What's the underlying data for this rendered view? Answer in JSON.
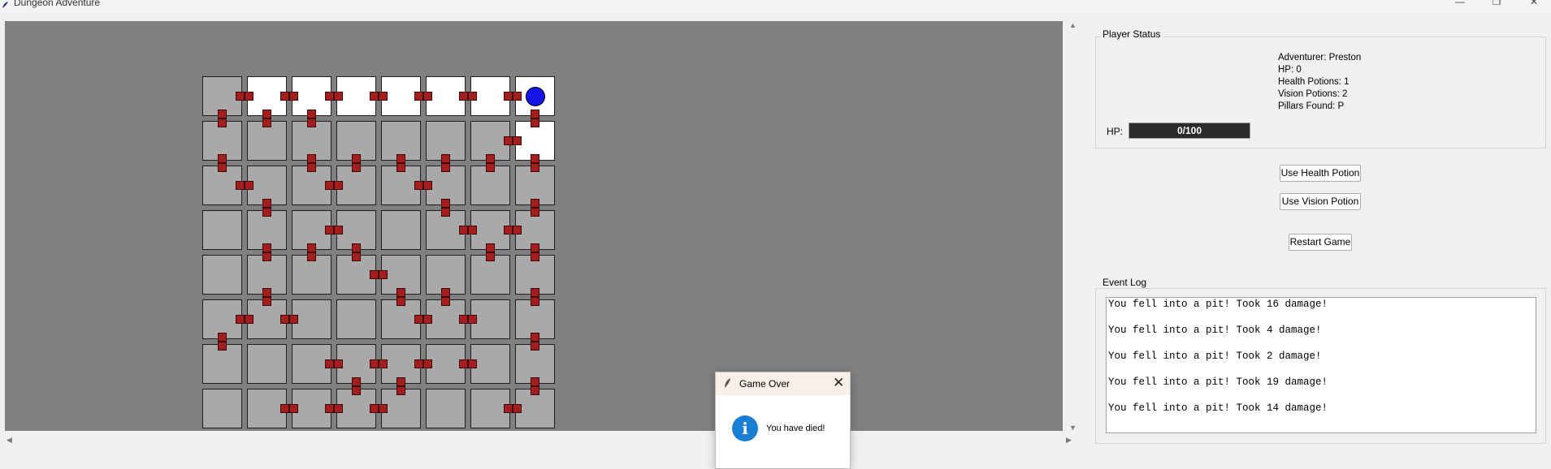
{
  "window": {
    "title": "Dungeon Adventure",
    "controls": {
      "minimize": "—",
      "maximize": "❐",
      "close": "✕"
    }
  },
  "map": {
    "grid_size": 8,
    "player_row": 0,
    "player_col": 7,
    "lit_rooms": [
      [
        0,
        1
      ],
      [
        0,
        2
      ],
      [
        0,
        3
      ],
      [
        0,
        4
      ],
      [
        0,
        5
      ],
      [
        0,
        6
      ],
      [
        0,
        7
      ],
      [
        1,
        7
      ]
    ],
    "doors": [
      [
        0,
        0,
        "E"
      ],
      [
        0,
        0,
        "S"
      ],
      [
        0,
        1,
        "W"
      ],
      [
        0,
        1,
        "E"
      ],
      [
        0,
        1,
        "S"
      ],
      [
        0,
        2,
        "W"
      ],
      [
        0,
        2,
        "E"
      ],
      [
        0,
        2,
        "S"
      ],
      [
        0,
        3,
        "W"
      ],
      [
        0,
        3,
        "E"
      ],
      [
        0,
        4,
        "W"
      ],
      [
        0,
        4,
        "E"
      ],
      [
        0,
        5,
        "W"
      ],
      [
        0,
        5,
        "E"
      ],
      [
        0,
        6,
        "W"
      ],
      [
        0,
        6,
        "E"
      ],
      [
        0,
        7,
        "W"
      ],
      [
        0,
        7,
        "S"
      ],
      [
        1,
        0,
        "N"
      ],
      [
        1,
        0,
        "S"
      ],
      [
        1,
        1,
        "N"
      ],
      [
        1,
        2,
        "N"
      ],
      [
        1,
        2,
        "S"
      ],
      [
        1,
        3,
        "S"
      ],
      [
        1,
        4,
        "S"
      ],
      [
        1,
        5,
        "S"
      ],
      [
        1,
        6,
        "E"
      ],
      [
        1,
        6,
        "S"
      ],
      [
        1,
        7,
        "N"
      ],
      [
        1,
        7,
        "W"
      ],
      [
        1,
        7,
        "S"
      ],
      [
        2,
        0,
        "N"
      ],
      [
        2,
        0,
        "E"
      ],
      [
        2,
        1,
        "W"
      ],
      [
        2,
        1,
        "S"
      ],
      [
        2,
        2,
        "N"
      ],
      [
        2,
        2,
        "E"
      ],
      [
        2,
        3,
        "W"
      ],
      [
        2,
        3,
        "N"
      ],
      [
        2,
        4,
        "N"
      ],
      [
        2,
        4,
        "E"
      ],
      [
        2,
        5,
        "W"
      ],
      [
        2,
        5,
        "N"
      ],
      [
        2,
        5,
        "S"
      ],
      [
        2,
        6,
        "N"
      ],
      [
        2,
        7,
        "N"
      ],
      [
        2,
        7,
        "S"
      ],
      [
        3,
        1,
        "N"
      ],
      [
        3,
        1,
        "S"
      ],
      [
        3,
        2,
        "E"
      ],
      [
        3,
        2,
        "S"
      ],
      [
        3,
        3,
        "W"
      ],
      [
        3,
        3,
        "S"
      ],
      [
        3,
        5,
        "N"
      ],
      [
        3,
        5,
        "E"
      ],
      [
        3,
        6,
        "W"
      ],
      [
        3,
        6,
        "E"
      ],
      [
        3,
        6,
        "S"
      ],
      [
        3,
        7,
        "N"
      ],
      [
        3,
        7,
        "W"
      ],
      [
        3,
        7,
        "S"
      ],
      [
        4,
        1,
        "N"
      ],
      [
        4,
        1,
        "S"
      ],
      [
        4,
        2,
        "N"
      ],
      [
        4,
        3,
        "N"
      ],
      [
        4,
        3,
        "E"
      ],
      [
        4,
        4,
        "W"
      ],
      [
        4,
        4,
        "S"
      ],
      [
        4,
        5,
        "S"
      ],
      [
        4,
        6,
        "N"
      ],
      [
        4,
        7,
        "N"
      ],
      [
        4,
        7,
        "S"
      ],
      [
        5,
        0,
        "E"
      ],
      [
        5,
        0,
        "S"
      ],
      [
        5,
        1,
        "W"
      ],
      [
        5,
        1,
        "N"
      ],
      [
        5,
        1,
        "E"
      ],
      [
        5,
        2,
        "W"
      ],
      [
        5,
        4,
        "N"
      ],
      [
        5,
        4,
        "E"
      ],
      [
        5,
        5,
        "W"
      ],
      [
        5,
        5,
        "N"
      ],
      [
        5,
        5,
        "E"
      ],
      [
        5,
        6,
        "W"
      ],
      [
        5,
        7,
        "N"
      ],
      [
        5,
        7,
        "S"
      ],
      [
        6,
        0,
        "N"
      ],
      [
        6,
        2,
        "E"
      ],
      [
        6,
        3,
        "W"
      ],
      [
        6,
        3,
        "E"
      ],
      [
        6,
        3,
        "S"
      ],
      [
        6,
        4,
        "W"
      ],
      [
        6,
        4,
        "E"
      ],
      [
        6,
        4,
        "S"
      ],
      [
        6,
        5,
        "W"
      ],
      [
        6,
        5,
        "E"
      ],
      [
        6,
        6,
        "W"
      ],
      [
        6,
        7,
        "N"
      ],
      [
        6,
        7,
        "S"
      ],
      [
        7,
        1,
        "E"
      ],
      [
        7,
        2,
        "W"
      ],
      [
        7,
        2,
        "E"
      ],
      [
        7,
        3,
        "W"
      ],
      [
        7,
        3,
        "N"
      ],
      [
        7,
        3,
        "E"
      ],
      [
        7,
        4,
        "W"
      ],
      [
        7,
        4,
        "N"
      ],
      [
        7,
        6,
        "E"
      ],
      [
        7,
        7,
        "W"
      ],
      [
        7,
        7,
        "N"
      ]
    ],
    "colors": {
      "background": "#808080",
      "room": "#a9a9a9",
      "lit_room": "#ffffff",
      "door": "#a41e1e",
      "player": "#1414e8"
    }
  },
  "status": {
    "frame_title": "Player Status",
    "adventurer": "Adventurer: Preston",
    "hp": "HP: 0",
    "health_potions": "Health Potions: 1",
    "vision_potions": "Vision Potions: 2",
    "pillars": "Pillars Found: P",
    "hp_label": "HP:",
    "hp_bar_text": "0/100",
    "hp_fraction": 0
  },
  "buttons": {
    "health": "Use Health Potion",
    "vision": "Use Vision Potion",
    "restart": "Restart Game"
  },
  "log": {
    "frame_title": "Event Log",
    "lines": [
      "You fell into a pit! Took 16 damage!",
      "You fell into a pit! Took 4 damage!",
      "You fell into a pit! Took 2 damage!",
      "You fell into a pit! Took 19 damage!",
      "You fell into a pit! Took 14 damage!"
    ]
  },
  "dialog": {
    "title": "Game Over",
    "message": "You have died!",
    "icon": "info-icon",
    "close": "✕"
  }
}
